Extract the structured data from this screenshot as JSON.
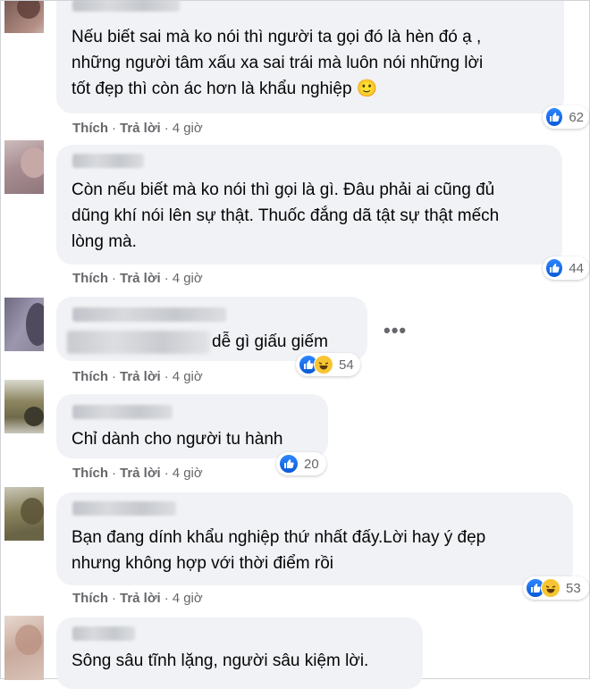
{
  "actions": {
    "like": "Thích",
    "reply": "Trả lời",
    "time": "4 giờ"
  },
  "more_label": "•••",
  "comments": [
    {
      "name": "",
      "text": "Nếu biết sai mà ko nói thì người ta gọi đó là hèn đó ạ ,\nnhững người tâm xấu xa sai trái mà luôn nói những lời\ntốt đẹp thì còn ác hơn là khẩu nghiệp 🙂",
      "reactions": [
        "like"
      ],
      "reaction_count": "62"
    },
    {
      "name": "",
      "text": "Còn nếu biết mà ko nói thì gọi là gì. Đâu phải ai cũng đủ\ndũng khí nói lên sự thật. Thuốc đắng dã tật sự thật mếch\nlòng mà.",
      "reactions": [
        "like"
      ],
      "reaction_count": "44"
    },
    {
      "name": "",
      "text": "dễ gì giấu giếm",
      "reactions": [
        "like",
        "haha"
      ],
      "reaction_count": "54"
    },
    {
      "name": "",
      "text": "Chỉ dành cho người tu hành",
      "reactions": [
        "like"
      ],
      "reaction_count": "20"
    },
    {
      "name": "",
      "text": "Bạn đang dính khẩu nghiệp thứ nhất đấy.Lời hay ý đẹp\nnhưng không hợp với thời điểm rồi",
      "reactions": [
        "like",
        "haha"
      ],
      "reaction_count": "53"
    },
    {
      "name": "",
      "text": "Sông sâu tĩnh lặng, người sâu kiệm lời.",
      "reactions": [],
      "reaction_count": ""
    }
  ]
}
